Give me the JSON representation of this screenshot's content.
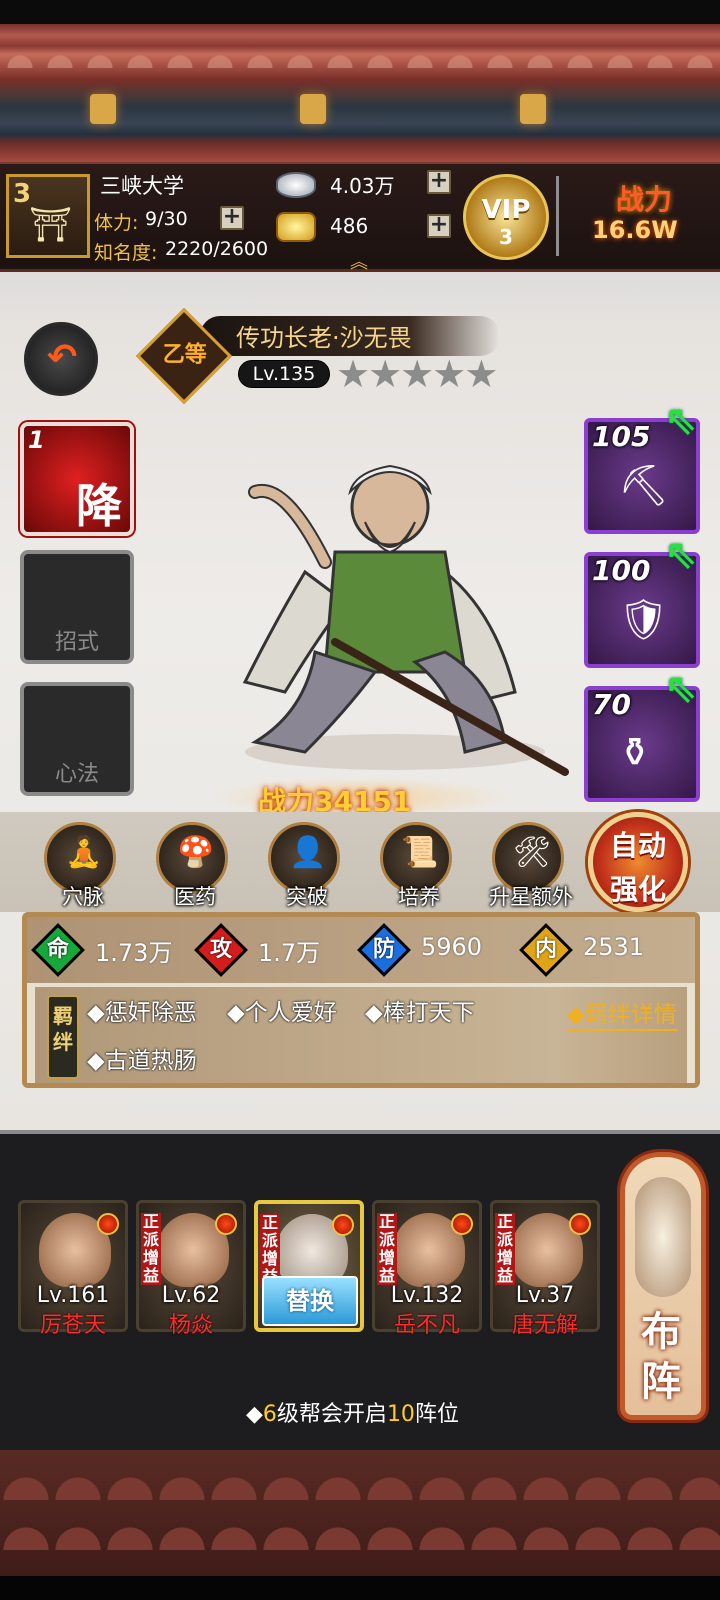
{
  "player": {
    "level": "3",
    "name": "三峡大学",
    "stamina_label": "体力:",
    "stamina": "9/30",
    "fame_label": "知名度:",
    "fame": "2220/2600"
  },
  "currency": {
    "silver": "4.03万",
    "gold": "486"
  },
  "vip": {
    "label": "VIP",
    "level": "3"
  },
  "power": {
    "label": "战力",
    "value": "16.6W"
  },
  "hero": {
    "grade": "乙等",
    "name": "传功长老·沙无畏",
    "level": "Lv.135",
    "stars_total": 5,
    "stars_filled": 0,
    "combat_power": "战力34151"
  },
  "left_slots": [
    {
      "num": "1",
      "char": "降"
    },
    {
      "label": "招式"
    },
    {
      "label": "心法"
    }
  ],
  "equipment": [
    {
      "level": "105",
      "item": "shovel-icon"
    },
    {
      "level": "100",
      "item": "armor-icon"
    },
    {
      "level": "70",
      "item": "teapot-icon"
    }
  ],
  "actions": [
    "穴脉",
    "医药",
    "突破",
    "培养",
    "升星额外"
  ],
  "auto_strengthen": {
    "line1": "自动",
    "line2": "强化"
  },
  "attributes": [
    {
      "icon": "命",
      "value": "1.73万",
      "color": "#16a83a"
    },
    {
      "icon": "攻",
      "value": "1.7万",
      "color": "#d41c1c"
    },
    {
      "icon": "防",
      "value": "5960",
      "color": "#1a6ee0"
    },
    {
      "icon": "内",
      "value": "2531",
      "color": "#e0a418"
    }
  ],
  "bonds": {
    "tag": "羁绊",
    "items": [
      "◆惩奸除恶",
      "◆个人爱好",
      "◆棒打天下",
      "◆古道热肠"
    ],
    "detail": "◆羁绊详情"
  },
  "lineup": [
    {
      "level": "Lv.161",
      "name": "厉苍天",
      "tag": ""
    },
    {
      "level": "Lv.62",
      "name": "杨焱",
      "tag": "正派增益"
    },
    {
      "level": "",
      "name": "",
      "tag": "正派增益",
      "swap": "替换"
    },
    {
      "level": "Lv.132",
      "name": "岳不凡",
      "tag": "正派增益"
    },
    {
      "level": "Lv.37",
      "name": "唐无解",
      "tag": "正派增益"
    }
  ],
  "formation": {
    "line1": "布",
    "line2": "阵"
  },
  "unlock_hint": {
    "prefix": "◆",
    "n1": "6",
    "mid": "级帮会开启",
    "n2": "10",
    "suffix": "阵位"
  }
}
